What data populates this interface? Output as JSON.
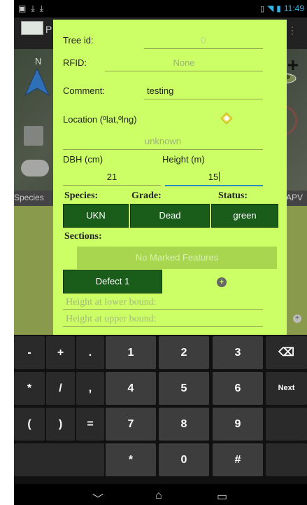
{
  "status_bar": {
    "time": "11:49"
  },
  "background_app": {
    "tab_left": "Species",
    "tab_right": "APV",
    "compass_label": "N"
  },
  "dialog": {
    "tree_id": {
      "label": "Tree id:",
      "value": "0"
    },
    "rfid": {
      "label": "RFID:",
      "value": "None"
    },
    "comment": {
      "label": "Comment:",
      "value": "testing"
    },
    "location": {
      "label": "Location (ºlat,ºlng)",
      "value": "unknown"
    },
    "dbh": {
      "label": "DBH (cm)",
      "value": "21"
    },
    "height": {
      "label": "Height (m)",
      "value": "15"
    },
    "species": {
      "label": "Species:",
      "value": "UKN"
    },
    "grade": {
      "label": "Grade:",
      "value": "Dead"
    },
    "status": {
      "label": "Status:",
      "value": "green"
    },
    "sections": {
      "label": "Sections:",
      "empty_text": "No Marked Features"
    },
    "defect_button": "Defect 1",
    "height_lower_placeholder": "Height at lower bound:",
    "height_upper_placeholder": "Height at upper bound:"
  },
  "keyboard": {
    "rows": [
      [
        "-",
        "+",
        ".",
        "1",
        "2",
        "3",
        "⌫"
      ],
      [
        "*",
        "/",
        ",",
        "4",
        "5",
        "6",
        "Next"
      ],
      [
        "(",
        ")",
        "=",
        "7",
        "8",
        "9",
        ""
      ],
      [
        "",
        "",
        "",
        "*",
        "0",
        "#",
        ""
      ]
    ]
  },
  "colors": {
    "dialog_bg": "#ccff66",
    "button_green": "#1a5c1a",
    "accent_blue": "#33b5e5"
  }
}
